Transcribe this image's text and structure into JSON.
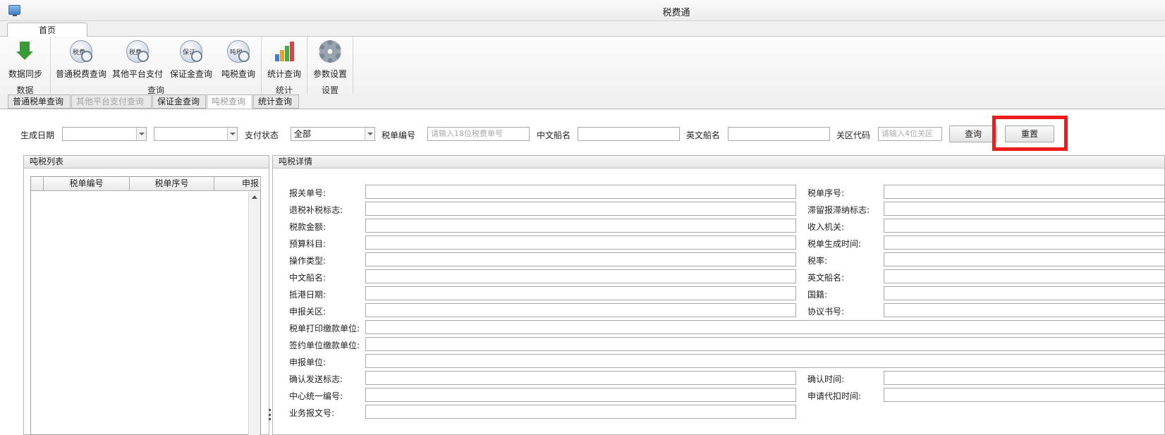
{
  "app": {
    "title": "税费通"
  },
  "ribbon": {
    "tab_home": "首页",
    "groups": [
      {
        "label": "数据",
        "buttons": [
          {
            "label": "数据同步",
            "icon": "download-arrow-icon"
          }
        ]
      },
      {
        "label": "查询",
        "buttons": [
          {
            "label": "普通税费查询",
            "icon": "tax-search-icon",
            "badge": "税费"
          },
          {
            "label": "其他平台支付",
            "icon": "tax-search-icon",
            "badge": "税费"
          },
          {
            "label": "保证金查询",
            "icon": "deposit-search-icon",
            "badge": "保证"
          },
          {
            "label": "吨税查询",
            "icon": "tonnage-search-icon",
            "badge": "吨税"
          }
        ]
      },
      {
        "label": "统计",
        "buttons": [
          {
            "label": "统计查询",
            "icon": "bar-chart-icon"
          }
        ]
      },
      {
        "label": "设置",
        "buttons": [
          {
            "label": "参数设置",
            "icon": "gear-icon"
          }
        ]
      }
    ]
  },
  "subtabs": [
    {
      "label": "普通税单查询",
      "state": "normal"
    },
    {
      "label": "其他平台支付查询",
      "state": "disabled"
    },
    {
      "label": "保证金查询",
      "state": "normal"
    },
    {
      "label": "吨税查询",
      "state": "active"
    },
    {
      "label": "统计查询",
      "state": "normal"
    }
  ],
  "filters": {
    "date_label": "生成日期",
    "status_label": "支付状态",
    "status_value": "全部",
    "bill_no_label": "税单编号",
    "bill_no_placeholder": "请输入18位税费单号",
    "cn_ship_label": "中文船名",
    "en_ship_label": "英文船名",
    "customs_label": "关区代码",
    "customs_placeholder": "请输入4位关区",
    "query_button": "查询",
    "reset_button": "重置"
  },
  "list_panel": {
    "title": "吨税列表",
    "columns": [
      "税单编号",
      "税单序号",
      "申报"
    ]
  },
  "detail_panel": {
    "title": "吨税详情",
    "left_fields": [
      "报关单号:",
      "退税补税标志:",
      "税款金额:",
      "预算科目:",
      "操作类型:",
      "中文船名:",
      "抵港日期:",
      "申报关区:"
    ],
    "right_fields": [
      "税单序号:",
      "滞留报滞纳标志:",
      "收入机关:",
      "税单生成时间:",
      "税率:",
      "英文船名:",
      "国籍:",
      "协议书号:"
    ],
    "wide_fields": [
      "税单打印缴款单位:",
      "签约单位缴款单位:",
      "申报单位:"
    ],
    "left_fields_2": [
      "确认发送标志:",
      "中心统一编号:",
      "业务报文号:"
    ],
    "right_fields_2": [
      "确认时间:",
      "申请代扣时间:"
    ]
  },
  "colors": {
    "highlight": "#ec1c1c",
    "sync_icon": "#3a9a3a"
  }
}
